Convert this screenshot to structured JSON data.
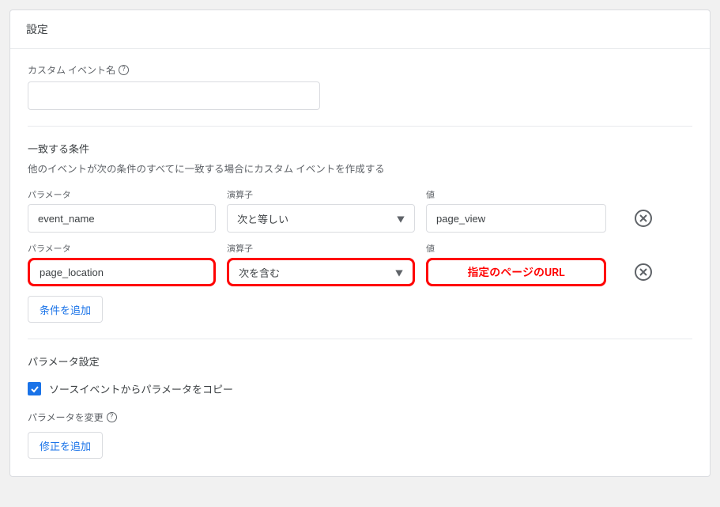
{
  "header": {
    "title": "設定"
  },
  "customEvent": {
    "label": "カスタム イベント名",
    "value": ""
  },
  "conditions": {
    "title": "一致する条件",
    "description": "他のイベントが次の条件のすべてに一致する場合にカスタム イベントを作成する",
    "columns": {
      "param": "パラメータ",
      "operator": "演算子",
      "value": "値"
    },
    "rows": [
      {
        "param": "event_name",
        "operator": "次と等しい",
        "value": "page_view",
        "highlight": false,
        "value_annotation": ""
      },
      {
        "param": "page_location",
        "operator": "次を含む",
        "value": "",
        "highlight": true,
        "value_annotation": "指定のページのURL"
      }
    ],
    "addButton": "条件を追加"
  },
  "paramSettings": {
    "title": "パラメータ設定",
    "copyCheckboxLabel": "ソースイベントからパラメータをコピー",
    "copyChecked": true,
    "modifyLabel": "パラメータを変更",
    "modifyButton": "修正を追加"
  }
}
